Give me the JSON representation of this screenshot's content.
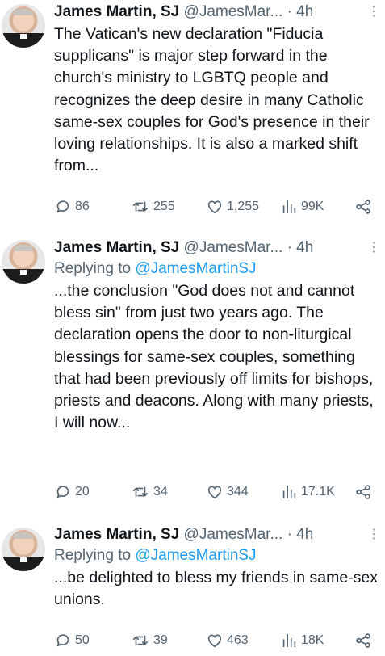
{
  "tweets": [
    {
      "name": "James Martin, SJ",
      "handle": "@JamesMar...",
      "time": "· 4h",
      "reply_prefix": "",
      "reply_to": "",
      "text": "The Vatican's new declaration \"Fiducia supplicans\" is major step forward in the church's ministry to LGBTQ people and recognizes the deep desire in many Catholic same-sex couples for God's presence in their loving relationships. It is also a marked shift from...",
      "replies": "86",
      "retweets": "255",
      "likes": "1,255",
      "views": "99K"
    },
    {
      "name": "James Martin, SJ",
      "handle": "@JamesMar...",
      "time": "· 4h",
      "reply_prefix": "Replying to ",
      "reply_to": "@JamesMartinSJ",
      "text": "...the conclusion \"God does not and cannot bless sin\" from just two years ago. The declaration opens the door to non-liturgical blessings for same-sex couples, something that had been previously off limits for bishops, priests and deacons. Along with many priests, I will now...",
      "replies": "20",
      "retweets": "34",
      "likes": "344",
      "views": "17.1K"
    },
    {
      "name": "James Martin, SJ",
      "handle": "@JamesMar...",
      "time": "· 4h",
      "reply_prefix": "Replying to ",
      "reply_to": "@JamesMartinSJ",
      "text": "...be delighted to bless my friends in same-sex unions.",
      "replies": "50",
      "retweets": "39",
      "likes": "463",
      "views": "18K"
    }
  ],
  "icons": {
    "more": "more-icon",
    "reply": "reply-icon",
    "retweet": "retweet-icon",
    "like": "heart-icon",
    "views": "views-icon",
    "share": "share-icon"
  },
  "colors": {
    "text": "#0f1419",
    "secondary": "#536471",
    "link": "#1d9bf0"
  }
}
